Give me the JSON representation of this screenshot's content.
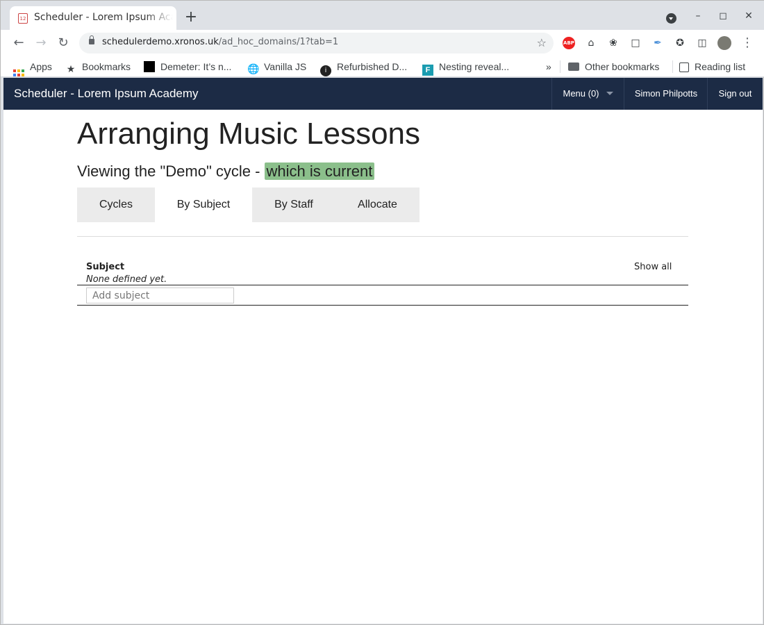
{
  "browser": {
    "tab_title": "Scheduler - Lorem Ipsum Academy",
    "favicon_text": "12",
    "url_host": "schedulerdemo.xronos.uk",
    "url_path": "/ad_hoc_domains/1?tab=1",
    "bookmarks": [
      {
        "label": "Apps",
        "icon": "apps-grid-icon"
      },
      {
        "label": "Bookmarks",
        "icon": "star-icon"
      },
      {
        "label": "Demeter: It’s n...",
        "icon": "black-square-icon"
      },
      {
        "label": "Vanilla JS",
        "icon": "globe-icon"
      },
      {
        "label": "Refurbished D...",
        "icon": "info-circle-icon"
      },
      {
        "label": "Nesting reveal...",
        "icon": "f-square-icon"
      }
    ],
    "overflow_label": "»",
    "other_bookmarks": "Other bookmarks",
    "reading_list": "Reading list"
  },
  "app": {
    "brand": "Scheduler - Lorem Ipsum Academy",
    "menu_label": "Menu (0)",
    "user_name": "Simon Philpotts",
    "sign_out": "Sign out"
  },
  "page": {
    "title": "Arranging Music Lessons",
    "subtitle_prefix": "Viewing the \"Demo\" cycle - ",
    "subtitle_badge": "which is current",
    "tabs": [
      {
        "label": "Cycles",
        "active": false
      },
      {
        "label": "By Subject",
        "active": true
      },
      {
        "label": "By Staff",
        "active": false
      },
      {
        "label": "Allocate",
        "active": false
      }
    ],
    "subjects": {
      "header": "Subject",
      "empty_text": "None defined yet.",
      "show_all": "Show all",
      "add_placeholder": "Add subject"
    }
  },
  "colors": {
    "topbar": "#1c2b45",
    "badge": "#8bbf8b",
    "tab_inactive": "#ebebeb"
  }
}
